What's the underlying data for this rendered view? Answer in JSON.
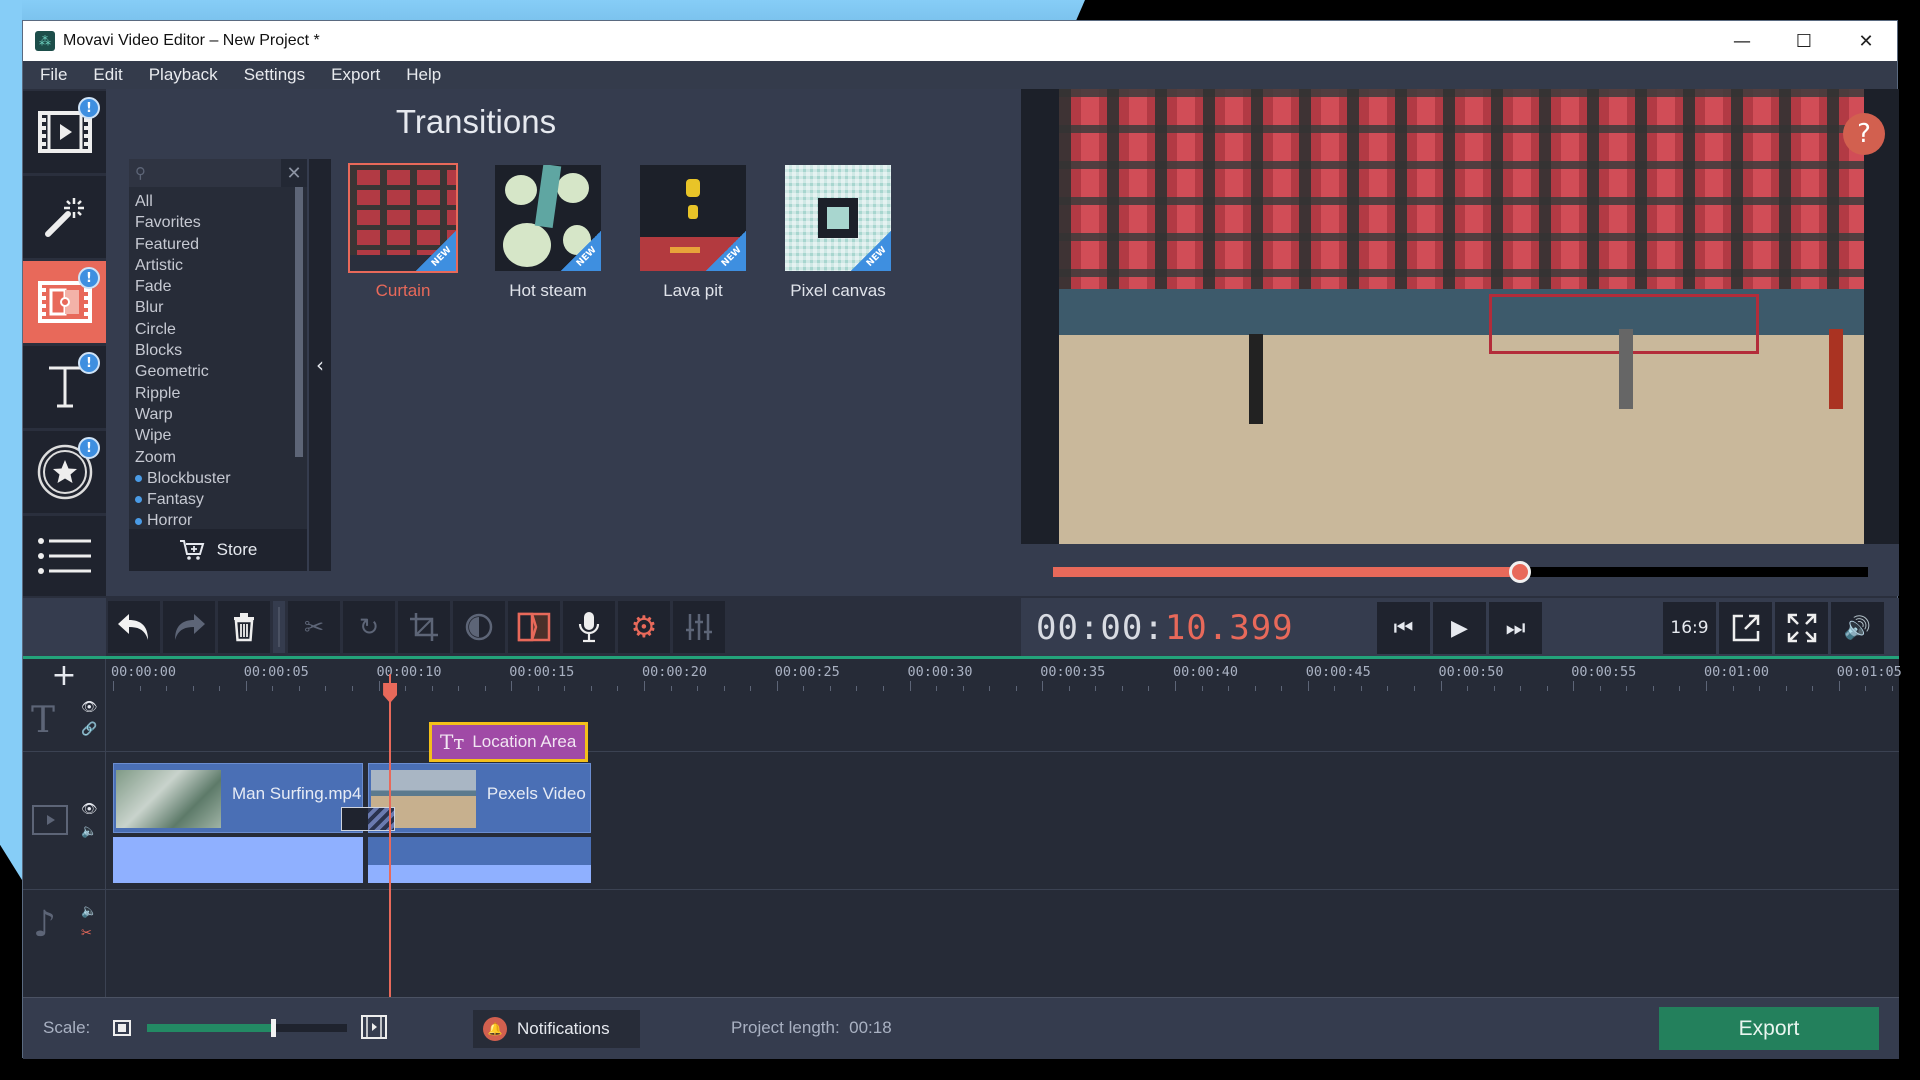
{
  "window": {
    "title": "Movavi Video Editor – New Project *",
    "controls": {
      "minimize": "—",
      "maximize": "☐",
      "close": "✕"
    }
  },
  "menu": [
    "File",
    "Edit",
    "Playback",
    "Settings",
    "Export",
    "Help"
  ],
  "sidebar": {
    "items": [
      {
        "name": "import-media",
        "icon": "film-play-icon",
        "badge": "!",
        "active": false
      },
      {
        "name": "filters",
        "icon": "magic-wand-icon",
        "badge": null,
        "active": false
      },
      {
        "name": "transitions",
        "icon": "transition-film-icon",
        "badge": "!",
        "active": true
      },
      {
        "name": "titles",
        "icon": "text-icon",
        "badge": "!",
        "active": false
      },
      {
        "name": "stickers",
        "icon": "star-circle-icon",
        "badge": "!",
        "active": false
      },
      {
        "name": "more-tools",
        "icon": "list-icon",
        "badge": null,
        "active": false
      }
    ]
  },
  "transitions": {
    "title": "Transitions",
    "search": {
      "placeholder": "",
      "value": ""
    },
    "categories": [
      {
        "label": "All",
        "dot": false
      },
      {
        "label": "Favorites",
        "dot": false
      },
      {
        "label": "Featured",
        "dot": false
      },
      {
        "label": "Artistic",
        "dot": false
      },
      {
        "label": "Fade",
        "dot": false
      },
      {
        "label": "Blur",
        "dot": false
      },
      {
        "label": "Circle",
        "dot": false
      },
      {
        "label": "Blocks",
        "dot": false
      },
      {
        "label": "Geometric",
        "dot": false
      },
      {
        "label": "Ripple",
        "dot": false
      },
      {
        "label": "Warp",
        "dot": false
      },
      {
        "label": "Wipe",
        "dot": false
      },
      {
        "label": "Zoom",
        "dot": false
      },
      {
        "label": "Blockbuster",
        "dot": true
      },
      {
        "label": "Fantasy",
        "dot": true
      },
      {
        "label": "Horror",
        "dot": true
      }
    ],
    "store_label": "Store",
    "items": [
      {
        "label": "Curtain",
        "tag": "NEW",
        "selected": true
      },
      {
        "label": "Hot steam",
        "tag": "NEW",
        "selected": false
      },
      {
        "label": "Lava pit",
        "tag": "NEW",
        "selected": false
      },
      {
        "label": "Pixel canvas",
        "tag": "NEW",
        "selected": false
      }
    ]
  },
  "preview": {
    "help_label": "?",
    "progress": 0.573,
    "timecode_prefix": "00:00:",
    "timecode_value": "10.399",
    "aspect_label": "16:9"
  },
  "toolbar": {
    "buttons": [
      "undo",
      "redo",
      "delete",
      "cut",
      "rotate",
      "crop",
      "color-adjust",
      "transition-wizard",
      "record-audio",
      "clip-properties",
      "equalizer"
    ]
  },
  "timeline": {
    "ticks": [
      "00:00:00",
      "00:00:05",
      "00:00:10",
      "00:00:15",
      "00:00:20",
      "00:00:25",
      "00:00:30",
      "00:00:35",
      "00:00:40",
      "00:00:45",
      "00:00:50",
      "00:00:55",
      "00:01:00",
      "00:01:05"
    ],
    "playhead_seconds": 10.399,
    "title_clip": {
      "label": "Location Area",
      "start": 11.9,
      "end": 17.9,
      "icon": "Tт"
    },
    "video_clips": [
      {
        "name": "Man Surfing.mp4",
        "start": 0,
        "end": 9.4
      },
      {
        "name": "Pexels Video",
        "start": 9.6,
        "end": 18
      }
    ]
  },
  "footer": {
    "scale_label": "Scale:",
    "scale_value": 0.63,
    "notifications_label": "Notifications",
    "project_length_label": "Project length:",
    "project_length_value": "00:18",
    "export_label": "Export"
  }
}
